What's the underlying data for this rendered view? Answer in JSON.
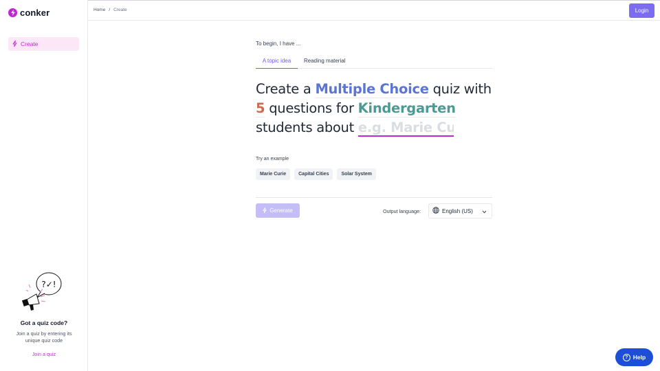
{
  "app": {
    "name": "conker"
  },
  "sidebar": {
    "nav": [
      {
        "label": "Create",
        "icon": "bolt-icon"
      }
    ],
    "quiz_code": {
      "title": "Got a quiz code?",
      "description": "Join a quiz by entering its unique quiz code",
      "link": "Join a quiz"
    }
  },
  "header": {
    "breadcrumb": [
      "Home",
      "Create"
    ],
    "breadcrumb_sep": "/",
    "login_label": "Login"
  },
  "main": {
    "intro": "To begin, I have ...",
    "tabs": [
      {
        "label": "A topic idea",
        "active": true
      },
      {
        "label": "Reading material",
        "active": false
      }
    ],
    "sentence": {
      "p1": "Create a",
      "quiz_type": "Multiple Choice",
      "p2": "quiz with",
      "question_count": "5",
      "p3": "questions for",
      "grade": "Kindergarten",
      "p4": "students about",
      "topic_placeholder": "e.g. Marie Curie",
      "topic_value": ""
    },
    "examples_label": "Try an example",
    "examples": [
      "Marie Curie",
      "Capital Cities",
      "Solar System"
    ],
    "generate_label": "Generate",
    "output_language_label": "Output language:",
    "output_language_value": "English (US)"
  },
  "help": {
    "label": "Help"
  },
  "colors": {
    "brand": "#c026d3",
    "accent": "#6d5ce8",
    "quiz_type": "#5a75d6",
    "question_count": "#d06a4f",
    "grade": "#4c9a94",
    "help": "#1d4ed8"
  }
}
